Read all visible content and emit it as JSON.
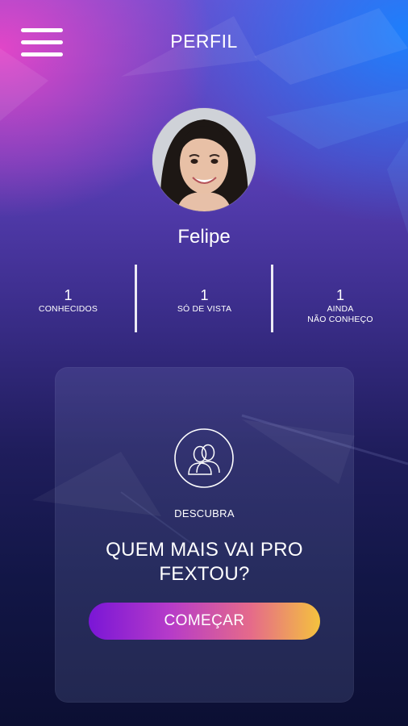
{
  "header": {
    "menu_icon": "hamburger-menu-icon",
    "title": "PERFIL"
  },
  "profile": {
    "name": "Felipe",
    "avatar": "profile-photo"
  },
  "stats": [
    {
      "value": "1",
      "label": "CONHECIDOS"
    },
    {
      "value": "1",
      "label": "SÓ DE VISTA"
    },
    {
      "value": "1",
      "label": "AINDA\nNÃO CONHEÇO"
    }
  ],
  "card": {
    "icon": "people-icon",
    "kicker": "DESCUBRA",
    "heading": "QUEM MAIS VAI PRO FEXTOU?",
    "button_label": "COMEÇAR"
  },
  "colors": {
    "accent_pink": "#e846c8",
    "accent_blue": "#1982ff",
    "button_start": "#7a16d6",
    "button_end": "#f4c23e"
  }
}
